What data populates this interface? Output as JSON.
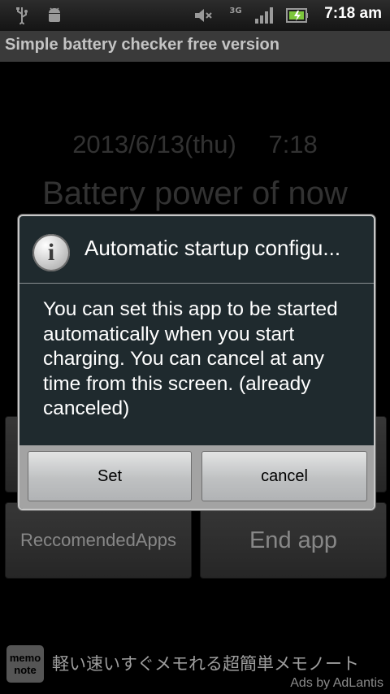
{
  "status_bar": {
    "icons": [
      "usb-icon",
      "android-debug-icon",
      "mute-icon",
      "network-3g-icon",
      "signal-icon",
      "battery-charging-icon"
    ],
    "network_label": "3G",
    "time": "7:18 am"
  },
  "app": {
    "title": "Simple battery checker free version",
    "date_display": "2013/6/13(thu)　 7:18",
    "heading": "Battery power of now"
  },
  "buttons": {
    "recommended_apps": "ReccomendedApps",
    "end_app": "End app"
  },
  "dialog": {
    "icon": "info-icon",
    "icon_glyph": "i",
    "title": "Automatic startup configu...",
    "message": "You can set this app to be started automatically when you start charging. You can cancel at any time from this screen. (already canceled)",
    "set_label": "Set",
    "cancel_label": "cancel"
  },
  "ad": {
    "logo_line1": "memo",
    "logo_line2": "note",
    "text": "軽い速いすぐメモれる超簡単メモノート",
    "attribution": "Ads by AdLantis"
  }
}
